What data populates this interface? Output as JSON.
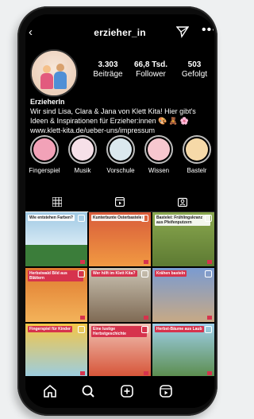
{
  "header": {
    "back_icon": "chevron-left-icon",
    "username": "erzieher_in",
    "send_icon": "paper-plane-icon",
    "more_icon": "more-dots-icon"
  },
  "profile": {
    "stats": [
      {
        "value": "3.303",
        "label": "Beiträge"
      },
      {
        "value": "66,8 Tsd.",
        "label": "Follower"
      },
      {
        "value": "503",
        "label": "Gefolgt"
      }
    ],
    "name": "ErzieherIn",
    "bio_line1": "Wir sind Lisa, Clara & Jana von Klett Kita! Hier gibt's",
    "bio_line2": "Ideen & Inspirationen für Erzieher:innen 🎨 🧸 🌸",
    "bio_link": "www.klett-kita.de/ueber-uns/impressum"
  },
  "highlights": [
    {
      "label": "Fingerspiel",
      "color": "#f2a2b8"
    },
    {
      "label": "Musik",
      "color": "#f6e0e8"
    },
    {
      "label": "Vorschule",
      "color": "#dbe8ee"
    },
    {
      "label": "Wissen",
      "color": "#f7c7cf"
    },
    {
      "label": "Bastelr",
      "color": "#f6d9a8"
    }
  ],
  "tabs": [
    {
      "icon": "grid-icon"
    },
    {
      "icon": "reels-icon"
    },
    {
      "icon": "tagged-icon"
    }
  ],
  "grid": [
    {
      "caption": "Wie entstehen Farben?",
      "tag": "",
      "bg": "linear-gradient(#9fc9e4 0,#d6e9f4 60%,#3b7d3a 60%)"
    },
    {
      "caption": "Kunterbunte Osterbastelei",
      "tag": "Basteln",
      "bg": "linear-gradient(#d85b3a 0,#f19a42 100%)"
    },
    {
      "caption": "Bastelei: Frühlingskranz aus Pfeifenputzern",
      "tag": "",
      "bg": "linear-gradient(#8aa84f 0,#5d7a32 100%)"
    },
    {
      "caption": "Herbstwald Bild aus Blättern",
      "tag": "",
      "bg": "linear-gradient(#e0792e 0,#f3b35a 100%)"
    },
    {
      "caption": "Wer hilft im Klett Kita?",
      "tag": "",
      "bg": "linear-gradient(#c9c2b2 0,#7f6a54 100%)"
    },
    {
      "caption": "Krähen basteln",
      "tag": "Basteln",
      "bg": "linear-gradient(#7a9bd1 0,#c7a985 100%)"
    },
    {
      "caption": "Fingerspiel für Kinder",
      "tag": "",
      "bg": "linear-gradient(#f4c647 0,#9acde3 100%)"
    },
    {
      "caption": "Eine lustige Herbstgeschichte",
      "tag": "",
      "bg": "linear-gradient(#f0c3b6 0,#d65235 100%)"
    },
    {
      "caption": "Herbst-Bäume aus Laub",
      "tag": "",
      "bg": "linear-gradient(#9fd0ea 0,#5a8c4b 100%)"
    }
  ],
  "nav": [
    {
      "icon": "home-icon"
    },
    {
      "icon": "search-icon"
    },
    {
      "icon": "add-post-icon"
    },
    {
      "icon": "reels-icon"
    }
  ]
}
